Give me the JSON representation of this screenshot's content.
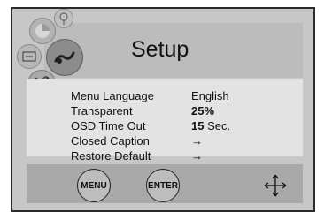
{
  "osd": {
    "title": "Setup",
    "items": [
      {
        "label": "Menu Language",
        "value": "English"
      },
      {
        "label": "Transparent",
        "value": "25%"
      },
      {
        "label": "OSD Time Out",
        "value": "15",
        "unit": "Sec."
      },
      {
        "label": "Closed Caption",
        "value": "→"
      },
      {
        "label": "Restore Default",
        "value": "→"
      }
    ],
    "buttons": {
      "menu_label": "MENU",
      "enter_label": "ENTER"
    },
    "icons": [
      "color-icon",
      "picture-icon",
      "settings-icon",
      "audio-icon",
      "tools-icon",
      "move-arrows-icon"
    ]
  }
}
